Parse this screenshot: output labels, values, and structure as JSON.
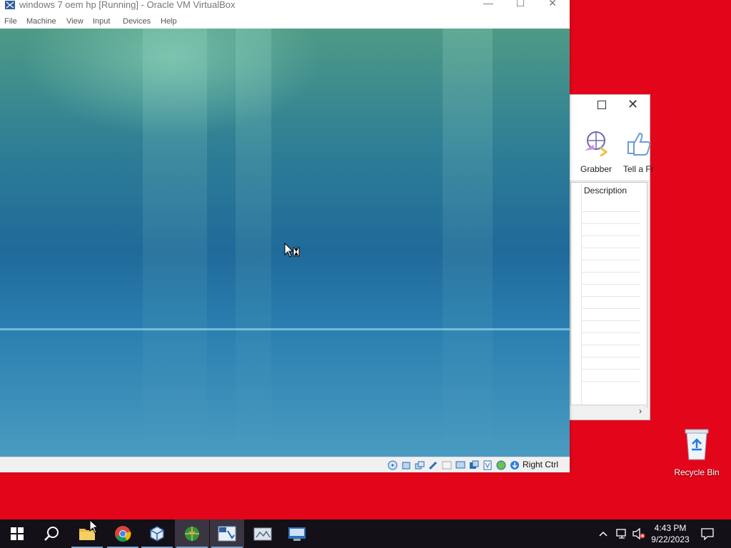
{
  "background_window": {
    "tools": [
      {
        "label": "Grabber",
        "icon": "grabber-icon"
      },
      {
        "label": "Tell a Fr",
        "icon": "thumbs-up-icon"
      }
    ],
    "list": {
      "column_header": "Description"
    }
  },
  "vbox": {
    "title": "windows 7 oem hp [Running] - Oracle VM VirtualBox",
    "menu": [
      "File",
      "Machine",
      "View",
      "Input",
      "Devices",
      "Help"
    ],
    "host_key": "Right Ctrl"
  },
  "desktop": {
    "icons": [
      {
        "label": "Recycle Bin",
        "icon": "recycle-bin-icon"
      }
    ]
  },
  "taskbar": {
    "apps": [
      "start-icon",
      "search-icon",
      "file-explorer-icon",
      "chrome-icon",
      "virtualbox-icon",
      "internet-download-manager-icon",
      "app-icon-2",
      "app-icon-3",
      "app-icon-4"
    ],
    "clock": {
      "time": "4:43 PM",
      "date": "9/22/2023"
    }
  },
  "colors": {
    "desktop": "#e3061a",
    "taskbar": "#141018"
  }
}
